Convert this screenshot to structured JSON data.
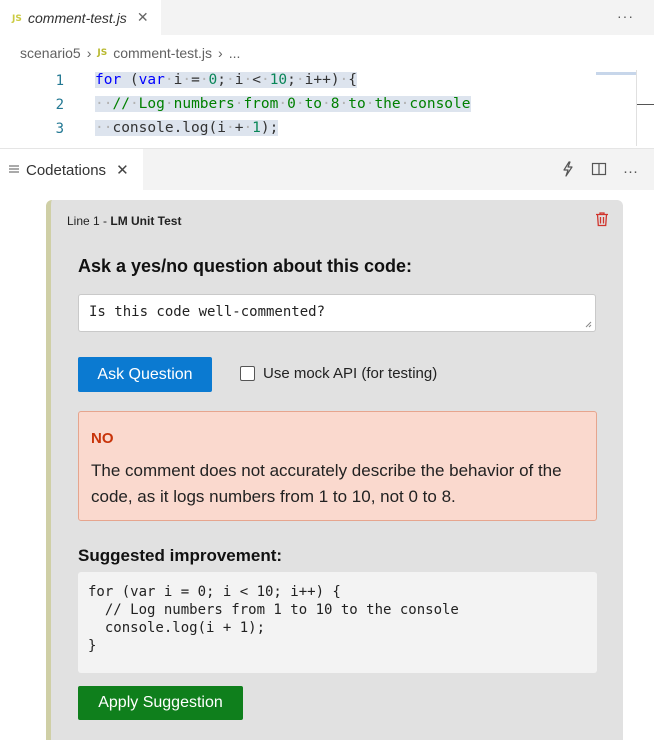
{
  "editor": {
    "tab": {
      "icon": "JS",
      "filename": "comment-test.js",
      "close": "✕"
    },
    "more": "···",
    "breadcrumb": {
      "folder": "scenario5",
      "icon": "JS",
      "file": "comment-test.js",
      "ellipsis": "..."
    },
    "lines": [
      {
        "number": "1"
      },
      {
        "number": "2"
      },
      {
        "number": "3"
      }
    ]
  },
  "panel": {
    "title": "Codetations",
    "close": "✕",
    "more": "···"
  },
  "card": {
    "line_label": "Line 1 - ",
    "annotation_type": "LM Unit Test",
    "question_heading": "Ask a yes/no question about this code:",
    "question_value": "Is this code well-commented?",
    "ask_button": "Ask Question",
    "mock_label": "Use mock API (for testing)",
    "mock_checked": false,
    "result": {
      "verdict": "NO",
      "message": "The comment does not accurately describe the behavior of the code, as it logs numbers from 1 to 10, not 0 to 8."
    },
    "suggestion_heading": "Suggested improvement:",
    "suggestion_code": "for (var i = 0; i < 10; i++) {\n  // Log numbers from 1 to 10 to the console\n  console.log(i + 1);\n}",
    "apply_button": "Apply Suggestion"
  },
  "colors": {
    "ask_button": "#0b7ad1",
    "apply_button": "#0f7f1c",
    "verdict_no": "#c8340a",
    "result_bg": "#fad9ce"
  }
}
